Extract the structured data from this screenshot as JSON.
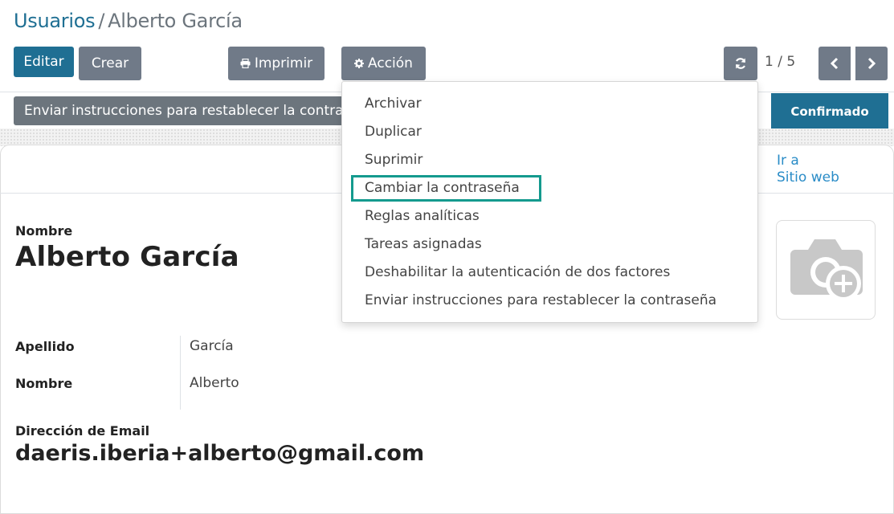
{
  "breadcrumb": {
    "parent": "Usuarios",
    "separator": "/",
    "current": "Alberto García"
  },
  "toolbar": {
    "edit_label": "Editar",
    "create_label": "Crear",
    "print_label": "Imprimir",
    "action_label": "Acción",
    "print_icon": "print-icon",
    "action_icon": "gear-icon"
  },
  "pager": {
    "value": "1 / 5"
  },
  "status_bar": {
    "button_label": "Enviar instrucciones para restablecer la contraseña",
    "stage_label": "Confirmado"
  },
  "smart_buttons": {
    "website_line1": "Ir a",
    "website_line2": "Sitio web"
  },
  "form": {
    "name_label": "Nombre",
    "name_value": "Alberto García",
    "lastname_label": "Apellido",
    "lastname_value": "García",
    "firstname_label": "Nombre",
    "firstname_value": "Alberto",
    "email_label": "Dirección de Email",
    "email_value": "daeris.iberia+alberto@gmail.com"
  },
  "action_menu": {
    "items": [
      {
        "label": "Archivar"
      },
      {
        "label": "Duplicar"
      },
      {
        "label": "Suprimir"
      },
      {
        "label": "Cambiar la contraseña",
        "highlighted": true
      },
      {
        "label": "Reglas analíticas"
      },
      {
        "label": "Tareas asignadas"
      },
      {
        "label": "Deshabilitar la autenticación de dos factores"
      },
      {
        "label": "Enviar instrucciones para restablecer la contraseña"
      }
    ]
  },
  "colors": {
    "primary": "#1f6f93",
    "secondary": "#707a88",
    "highlight": "#149a8e",
    "link": "#2a8cc7"
  }
}
